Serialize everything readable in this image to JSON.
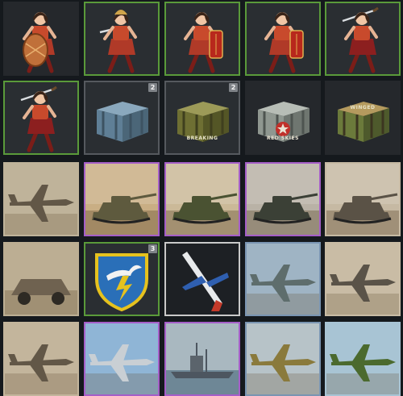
{
  "inventory": {
    "items": [
      {
        "row": 0,
        "col": 0,
        "kind": "decal-warrior-shield",
        "frame": "none",
        "bg": "#25282c"
      },
      {
        "row": 0,
        "col": 1,
        "kind": "decal-warrior-helmet",
        "frame": "green",
        "bg": "#2a2e32"
      },
      {
        "row": 0,
        "col": 2,
        "kind": "decal-warrior-shield-red",
        "frame": "green",
        "bg": "#2a2e32"
      },
      {
        "row": 0,
        "col": 3,
        "kind": "decal-warrior-shield-red",
        "frame": "green",
        "bg": "#2a2e32"
      },
      {
        "row": 0,
        "col": 4,
        "kind": "decal-warrior-sword",
        "frame": "green",
        "bg": "#2a2e32"
      },
      {
        "row": 1,
        "col": 0,
        "kind": "decal-warrior-sword",
        "frame": "green",
        "bg": "#2a2e32"
      },
      {
        "row": 1,
        "col": 1,
        "kind": "crate-steel",
        "frame": "gray",
        "bg": "#2a2e32",
        "badge": "2",
        "crate_label": ""
      },
      {
        "row": 1,
        "col": 2,
        "kind": "crate-green",
        "frame": "gray",
        "bg": "#2a2e32",
        "badge": "2",
        "crate_label": "BREAKING"
      },
      {
        "row": 1,
        "col": 3,
        "kind": "crate-redskies",
        "frame": "none",
        "bg": "#25282c",
        "crate_label": "RED SKIES"
      },
      {
        "row": 1,
        "col": 4,
        "kind": "crate-winged",
        "frame": "none",
        "bg": "#25282c",
        "crate_label": "WINGED"
      },
      {
        "row": 2,
        "col": 0,
        "kind": "photo-plane-sepia",
        "frame": "none",
        "bg": "#bfb39a"
      },
      {
        "row": 2,
        "col": 1,
        "kind": "photo-tank-desert",
        "frame": "purple",
        "bg": "#c9ae84"
      },
      {
        "row": 2,
        "col": 2,
        "kind": "photo-tank-green",
        "frame": "purple",
        "bg": "#cbb998"
      },
      {
        "row": 2,
        "col": 3,
        "kind": "photo-tank-dark",
        "frame": "purple",
        "bg": "#b9b2a6"
      },
      {
        "row": 2,
        "col": 4,
        "kind": "photo-tank-sepia",
        "frame": "none",
        "bg": "#c6b9a3"
      },
      {
        "row": 3,
        "col": 0,
        "kind": "photo-car-sepia",
        "frame": "none",
        "bg": "#bcae93"
      },
      {
        "row": 3,
        "col": 1,
        "kind": "decal-emblem-blue",
        "frame": "green",
        "bg": "#2a2e32",
        "badge": "3"
      },
      {
        "row": 3,
        "col": 2,
        "kind": "decal-jet-white",
        "frame": "white",
        "bg": "#1d2024"
      },
      {
        "row": 3,
        "col": 3,
        "kind": "photo-jet-phantom",
        "frame": "blue",
        "bg": "#9fb4c4"
      },
      {
        "row": 3,
        "col": 4,
        "kind": "photo-plane-corsair",
        "frame": "none",
        "bg": "#c9bca5"
      },
      {
        "row": 4,
        "col": 0,
        "kind": "photo-plane-sepia2",
        "frame": "none",
        "bg": "#c3b59c"
      },
      {
        "row": 4,
        "col": 1,
        "kind": "photo-plane-sky",
        "frame": "purple",
        "bg": "#8fb5d6"
      },
      {
        "row": 4,
        "col": 2,
        "kind": "photo-ship",
        "frame": "purple",
        "bg": "#a9b8c0"
      },
      {
        "row": 4,
        "col": 3,
        "kind": "photo-plane-camo",
        "frame": "blue",
        "bg": "#b7c3c8"
      },
      {
        "row": 4,
        "col": 4,
        "kind": "photo-jet-green",
        "frame": "none",
        "bg": "#a8c4d4"
      }
    ]
  }
}
